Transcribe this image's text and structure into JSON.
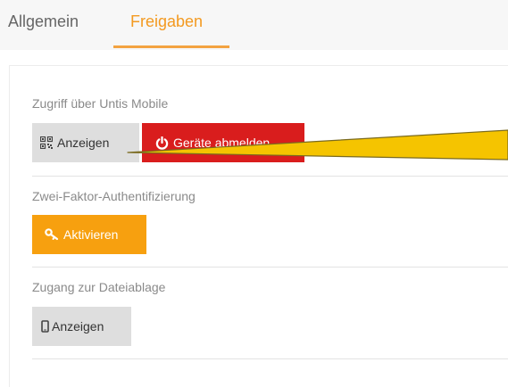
{
  "tabs": [
    {
      "label": "Allgemein",
      "active": false
    },
    {
      "label": "Freigaben",
      "active": true
    }
  ],
  "sections": {
    "mobile": {
      "label": "Zugriff über Untis Mobile",
      "show_button": "Anzeigen",
      "logout_button": "Geräte abmelden"
    },
    "twofactor": {
      "label": "Zwei-Faktor-Authentifizierung",
      "activate_button": "Aktivieren"
    },
    "storage": {
      "label": "Zugang zur Dateiablage",
      "show_button": "Anzeigen"
    }
  },
  "colors": {
    "accent": "#f39a21",
    "danger": "#d91d1d",
    "warning": "#f7a00f",
    "neutral_button": "#dedede",
    "annotation_arrow": "#f5c400"
  },
  "icons": {
    "qr": "qr-code-icon",
    "power": "power-icon",
    "key": "key-icon",
    "phone": "mobile-phone-icon"
  }
}
